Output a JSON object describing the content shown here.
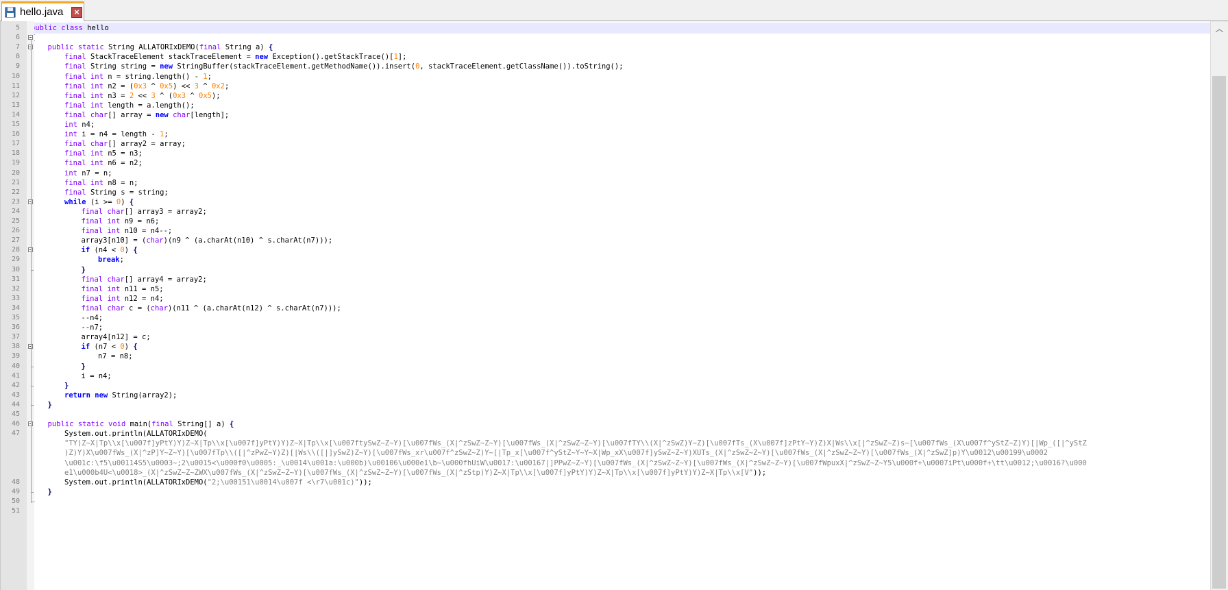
{
  "tab": {
    "title": "hello.java",
    "file_icon": "floppy-disk-icon",
    "close_icon": "close-icon"
  },
  "colors": {
    "keyword": "#0000ff",
    "type": "#8000ff",
    "number": "#ff8000",
    "string": "#808080",
    "caret_line": "#e8e8ff",
    "tab_accent": "#f5a623"
  },
  "editor": {
    "lines": [
      {
        "n": "5",
        "indent": 0,
        "fold": "",
        "parts": [
          [
            "ty",
            "public "
          ],
          [
            "ty",
            "class "
          ],
          [
            "",
            "hello"
          ]
        ]
      },
      {
        "n": "6",
        "indent": 0,
        "fold": "box",
        "parts": [
          [
            "op",
            "{"
          ]
        ]
      },
      {
        "n": "7",
        "indent": 1,
        "fold": "box",
        "parts": [
          [
            "ty",
            "public "
          ],
          [
            "ty",
            "static "
          ],
          [
            "",
            "String ALLATORIxDEMO("
          ],
          [
            "ty",
            "final "
          ],
          [
            "",
            "String a) "
          ],
          [
            "op",
            "{"
          ]
        ]
      },
      {
        "n": "8",
        "indent": 2,
        "fold": "",
        "parts": [
          [
            "ty",
            "final "
          ],
          [
            "",
            "StackTraceElement stackTraceElement = "
          ],
          [
            "kw",
            "new "
          ],
          [
            "",
            "Exception().getStackTrace()["
          ],
          [
            "num",
            "1"
          ],
          [
            "",
            "];"
          ]
        ]
      },
      {
        "n": "9",
        "indent": 2,
        "fold": "",
        "parts": [
          [
            "ty",
            "final "
          ],
          [
            "",
            "String string = "
          ],
          [
            "kw",
            "new "
          ],
          [
            "",
            "StringBuffer(stackTraceElement.getMethodName()).insert("
          ],
          [
            "num",
            "0"
          ],
          [
            "",
            ", stackTraceElement.getClassName()).toString();"
          ]
        ]
      },
      {
        "n": "10",
        "indent": 2,
        "fold": "",
        "parts": [
          [
            "ty",
            "final int "
          ],
          [
            "",
            "n = string.length() - "
          ],
          [
            "num",
            "1"
          ],
          [
            "",
            ";"
          ]
        ]
      },
      {
        "n": "11",
        "indent": 2,
        "fold": "",
        "parts": [
          [
            "ty",
            "final int "
          ],
          [
            "",
            "n2 = ("
          ],
          [
            "num",
            "0x3"
          ],
          [
            "",
            " ^ "
          ],
          [
            "num",
            "0x5"
          ],
          [
            "",
            ") << "
          ],
          [
            "num",
            "3"
          ],
          [
            "",
            " ^ "
          ],
          [
            "num",
            "0x2"
          ],
          [
            "",
            ";"
          ]
        ]
      },
      {
        "n": "12",
        "indent": 2,
        "fold": "",
        "parts": [
          [
            "ty",
            "final int "
          ],
          [
            "",
            "n3 = "
          ],
          [
            "num",
            "2"
          ],
          [
            "",
            " << "
          ],
          [
            "num",
            "3"
          ],
          [
            "",
            " ^ ("
          ],
          [
            "num",
            "0x3"
          ],
          [
            "",
            " ^ "
          ],
          [
            "num",
            "0x5"
          ],
          [
            "",
            ");"
          ]
        ]
      },
      {
        "n": "13",
        "indent": 2,
        "fold": "",
        "parts": [
          [
            "ty",
            "final int "
          ],
          [
            "",
            "length = a.length();"
          ]
        ]
      },
      {
        "n": "14",
        "indent": 2,
        "fold": "",
        "parts": [
          [
            "ty",
            "final char"
          ],
          [
            "",
            "[] array = "
          ],
          [
            "kw",
            "new "
          ],
          [
            "ty",
            "char"
          ],
          [
            "",
            "[length];"
          ]
        ]
      },
      {
        "n": "15",
        "indent": 2,
        "fold": "",
        "parts": [
          [
            "ty",
            "int "
          ],
          [
            "",
            "n4;"
          ]
        ]
      },
      {
        "n": "16",
        "indent": 2,
        "fold": "",
        "parts": [
          [
            "ty",
            "int "
          ],
          [
            "",
            "i = n4 = length - "
          ],
          [
            "num",
            "1"
          ],
          [
            "",
            ";"
          ]
        ]
      },
      {
        "n": "17",
        "indent": 2,
        "fold": "",
        "parts": [
          [
            "ty",
            "final char"
          ],
          [
            "",
            "[] array2 = array;"
          ]
        ]
      },
      {
        "n": "18",
        "indent": 2,
        "fold": "",
        "parts": [
          [
            "ty",
            "final int "
          ],
          [
            "",
            "n5 = n3;"
          ]
        ]
      },
      {
        "n": "19",
        "indent": 2,
        "fold": "",
        "parts": [
          [
            "ty",
            "final int "
          ],
          [
            "",
            "n6 = n2;"
          ]
        ]
      },
      {
        "n": "20",
        "indent": 2,
        "fold": "",
        "parts": [
          [
            "ty",
            "int "
          ],
          [
            "",
            "n7 = n;"
          ]
        ]
      },
      {
        "n": "21",
        "indent": 2,
        "fold": "",
        "parts": [
          [
            "ty",
            "final int "
          ],
          [
            "",
            "n8 = n;"
          ]
        ]
      },
      {
        "n": "22",
        "indent": 2,
        "fold": "",
        "parts": [
          [
            "ty",
            "final "
          ],
          [
            "",
            "String s = string;"
          ]
        ]
      },
      {
        "n": "23",
        "indent": 2,
        "fold": "box",
        "parts": [
          [
            "kw",
            "while "
          ],
          [
            "",
            "(i >= "
          ],
          [
            "num",
            "0"
          ],
          [
            "",
            ") "
          ],
          [
            "op",
            "{"
          ]
        ]
      },
      {
        "n": "24",
        "indent": 3,
        "fold": "",
        "parts": [
          [
            "ty",
            "final char"
          ],
          [
            "",
            "[] array3 = array2;"
          ]
        ]
      },
      {
        "n": "25",
        "indent": 3,
        "fold": "",
        "parts": [
          [
            "ty",
            "final int "
          ],
          [
            "",
            "n9 = n6;"
          ]
        ]
      },
      {
        "n": "26",
        "indent": 3,
        "fold": "",
        "parts": [
          [
            "ty",
            "final int "
          ],
          [
            "",
            "n10 = n4--;"
          ]
        ]
      },
      {
        "n": "27",
        "indent": 3,
        "fold": "",
        "parts": [
          [
            "",
            "array3[n10] = ("
          ],
          [
            "ty",
            "char"
          ],
          [
            "",
            ")(n9 ^ (a.charAt(n10) ^ s.charAt(n7)));"
          ]
        ]
      },
      {
        "n": "28",
        "indent": 3,
        "fold": "box",
        "parts": [
          [
            "kw",
            "if "
          ],
          [
            "",
            "(n4 < "
          ],
          [
            "num",
            "0"
          ],
          [
            "",
            ") "
          ],
          [
            "op",
            "{"
          ]
        ]
      },
      {
        "n": "29",
        "indent": 4,
        "fold": "",
        "parts": [
          [
            "kw",
            "break"
          ],
          [
            "",
            ";"
          ]
        ]
      },
      {
        "n": "30",
        "indent": 3,
        "fold": "end",
        "parts": [
          [
            "op",
            "}"
          ]
        ]
      },
      {
        "n": "31",
        "indent": 3,
        "fold": "",
        "parts": [
          [
            "ty",
            "final char"
          ],
          [
            "",
            "[] array4 = array2;"
          ]
        ]
      },
      {
        "n": "32",
        "indent": 3,
        "fold": "",
        "parts": [
          [
            "ty",
            "final int "
          ],
          [
            "",
            "n11 = n5;"
          ]
        ]
      },
      {
        "n": "33",
        "indent": 3,
        "fold": "",
        "parts": [
          [
            "ty",
            "final int "
          ],
          [
            "",
            "n12 = n4;"
          ]
        ]
      },
      {
        "n": "34",
        "indent": 3,
        "fold": "",
        "parts": [
          [
            "ty",
            "final char "
          ],
          [
            "",
            "c = ("
          ],
          [
            "ty",
            "char"
          ],
          [
            "",
            ")(n11 ^ (a.charAt(n12) ^ s.charAt(n7)));"
          ]
        ]
      },
      {
        "n": "35",
        "indent": 3,
        "fold": "",
        "parts": [
          [
            "",
            "--n4;"
          ]
        ]
      },
      {
        "n": "36",
        "indent": 3,
        "fold": "",
        "parts": [
          [
            "",
            "--n7;"
          ]
        ]
      },
      {
        "n": "37",
        "indent": 3,
        "fold": "",
        "parts": [
          [
            "",
            "array4[n12] = c;"
          ]
        ]
      },
      {
        "n": "38",
        "indent": 3,
        "fold": "box",
        "parts": [
          [
            "kw",
            "if "
          ],
          [
            "",
            "(n7 < "
          ],
          [
            "num",
            "0"
          ],
          [
            "",
            ") "
          ],
          [
            "op",
            "{"
          ]
        ]
      },
      {
        "n": "39",
        "indent": 4,
        "fold": "",
        "parts": [
          [
            "",
            "n7 = n8;"
          ]
        ]
      },
      {
        "n": "40",
        "indent": 3,
        "fold": "end",
        "parts": [
          [
            "op",
            "}"
          ]
        ]
      },
      {
        "n": "41",
        "indent": 3,
        "fold": "",
        "parts": [
          [
            "",
            "i = n4;"
          ]
        ]
      },
      {
        "n": "42",
        "indent": 2,
        "fold": "end",
        "parts": [
          [
            "op",
            "}"
          ]
        ]
      },
      {
        "n": "43",
        "indent": 2,
        "fold": "",
        "parts": [
          [
            "kw",
            "return new "
          ],
          [
            "",
            "String(array2);"
          ]
        ]
      },
      {
        "n": "44",
        "indent": 1,
        "fold": "end",
        "parts": [
          [
            "op",
            "}"
          ]
        ]
      },
      {
        "n": "45",
        "indent": 0,
        "fold": "",
        "parts": []
      },
      {
        "n": "46",
        "indent": 1,
        "fold": "box",
        "parts": [
          [
            "ty",
            "public static void "
          ],
          [
            "",
            "main("
          ],
          [
            "ty",
            "final "
          ],
          [
            "",
            "String[] a) "
          ],
          [
            "op",
            "{"
          ]
        ]
      },
      {
        "n": "47",
        "indent": 2,
        "fold": "",
        "parts": [
          [
            "",
            "System.out.println(ALLATORIxDEMO("
          ]
        ]
      },
      {
        "n": "",
        "indent": 2,
        "fold": "",
        "parts": [
          [
            "str",
            "\"TY)Z~X|Tp\\\\x[\\u007f]yPtY)Y)Z~X|Tp\\\\x[\\u007f]yPtY)Y)Z~X|Tp\\\\x[\\u007ftySwZ~Z~Y)[\\u007fWs_(X|^zSwZ~Z~Y)[\\u007fWs_(X|^zSwZ~Z~Y)[\\u007fTY\\\\(X|^zSwZ)Y~Z)[\\u007fTs_(X\\u007f]zPtY~Y)Z)X|Ws\\\\x[|^zSwZ~Z)s~[\\u007fWs_(X\\u007f^yStZ~Z)Y)[|Wp_([|^yStZ"
          ]
        ]
      },
      {
        "n": "",
        "indent": 2,
        "fold": "",
        "parts": [
          [
            "str",
            ")Z)Y)X\\u007fWs_(X|^zP]Y~Z~Y)[\\u007fTp\\\\([|^zPwZ~Y)Z)[|Ws\\\\([|]ySwZ)Z~Y)[\\u007fWs_xr\\u007f^zSwZ~Z)Y~[|Tp_x[\\u007f^yStZ~Y~Y~X|Wp_xX\\u007f]ySwZ~Z~Y)XUTs_(X|^zSwZ~Z~Y)[\\u007fWs_(X|^zSwZ~Z~Y)[\\u007fWs_(X|^zSwZ]p)Y\\u0012\\u00199\\u0002"
          ]
        ]
      },
      {
        "n": "",
        "indent": 2,
        "fold": "",
        "parts": [
          [
            "str",
            "\\u001c:\\f5\\u00114S5\\u0003~;2\\u0015<\\u000f0\\u0005:_\\u0014\\u001a:\\u000b)\\u00106\\u000e1\\b~\\u000fhUiW\\u0017:\\u00167|]PPwZ~Z~Y)[\\u007fWs_(X|^zSwZ~Z~Y)[\\u007fWs_(X|^zSwZ~Z~Y)[\\u007fWpuxX|^zSwZ~Z~Y5\\u000f+\\u0007iPt\\u000f+\\tt\\u0012;\\u0016?\\u000"
          ]
        ]
      },
      {
        "n": "",
        "indent": 2,
        "fold": "",
        "parts": [
          [
            "str",
            "e1\\u000b4U<\\u0018>_(X|^zSwZ~Z~ZWX\\u007fWs_(X|^zSwZ~Z~Y)[\\u007fWs_(X|^zSwZ~Z~Y)[\\u007fWs_(X|^zStp)Y)Z~X|Tp\\\\x[\\u007f]yPtY)Y)Z~X|Tp\\\\x[\\u007f]yPtY)Y)Z~X|Tp\\\\x[V\""
          ],
          [
            "",
            "));"
          ]
        ]
      },
      {
        "n": "48",
        "indent": 2,
        "fold": "",
        "parts": [
          [
            "",
            "System.out.println(ALLATORIxDEMO("
          ],
          [
            "str",
            "\"2;\\u00151\\u0014\\u007f <\\r7\\u001c)\""
          ],
          [
            "",
            "));"
          ]
        ]
      },
      {
        "n": "49",
        "indent": 1,
        "fold": "end",
        "parts": [
          [
            "op",
            "}"
          ]
        ]
      },
      {
        "n": "50",
        "indent": 0,
        "fold": "end",
        "parts": [
          [
            "op",
            "}"
          ]
        ]
      },
      {
        "n": "51",
        "indent": 0,
        "fold": "",
        "parts": []
      }
    ]
  },
  "scrollbar": {
    "up_icon": "chevron-up-icon",
    "up_glyph": "︿"
  }
}
